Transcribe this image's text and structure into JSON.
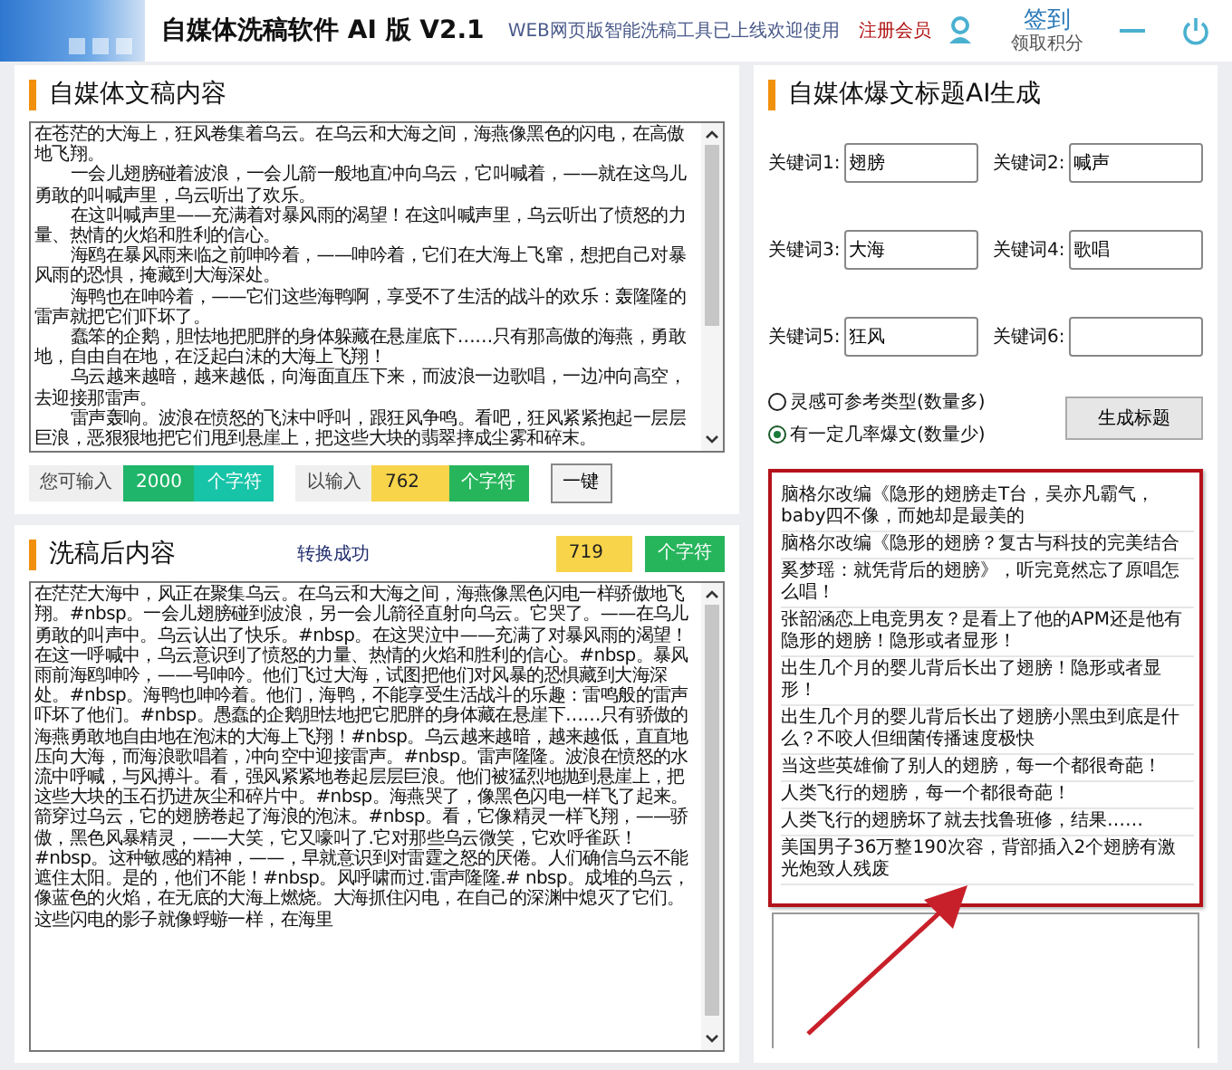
{
  "header": {
    "title": "自媒体洗稿软件 AI 版 V2.1",
    "notice": "WEB网页版智能洗稿工具已上线欢迎使用",
    "register": "注册会员",
    "checkin": "签到",
    "checkin_sub": "领取积分"
  },
  "source": {
    "title": "自媒体文稿内容",
    "paragraphs": [
      "在苍茫的大海上，狂风卷集着乌云。在乌云和大海之间，海燕像黑色的闪电，在高傲地飞翔。",
      "一会儿翅膀碰着波浪，一会儿箭一般地直冲向乌云，它叫喊着，——就在这鸟儿勇敢的叫喊声里，乌云听出了欢乐。",
      "在这叫喊声里——充满着对暴风雨的渴望！在这叫喊声里，乌云听出了愤怒的力量、热情的火焰和胜利的信心。",
      "海鸥在暴风雨来临之前呻吟着，——呻吟着，它们在大海上飞窜，想把自己对暴风雨的恐惧，掩藏到大海深处。",
      "海鸭也在呻吟着，——它们这些海鸭啊，享受不了生活的战斗的欢乐：轰隆隆的雷声就把它们吓坏了。",
      "蠢笨的企鹅，胆怯地把肥胖的身体躲藏在悬崖底下……只有那高傲的海燕，勇敢地，自由自在地，在泛起白沫的大海上飞翔！",
      "乌云越来越暗，越来越低，向海面直压下来，而波浪一边歌唱，一边冲向高空，去迎接那雷声。",
      "雷声轰响。波浪在愤怒的飞沫中呼叫，跟狂风争鸣。看吧，狂风紧紧抱起一层层巨浪，恶狠狠地把它们甩到悬崖上，把这些大块的翡翠摔成尘雾和碎末。"
    ],
    "limit_label": "您可输入",
    "limit_count": "2000",
    "limit_unit": "个字符",
    "input_label": "以输入",
    "input_count": "762",
    "input_unit": "个字符",
    "action_button": "一键"
  },
  "output": {
    "title": "洗稿后内容",
    "status": "转换成功",
    "count": "719",
    "unit": "个字符",
    "text": "在茫茫大海中，风正在聚集乌云。在乌云和大海之间，海燕像黑色闪电一样骄傲地飞翔。#nbsp。一会儿翅膀碰到波浪，另一会儿箭径直射向乌云。它哭了。——在乌儿勇敢的叫声中。乌云认出了快乐。#nbsp。在这哭泣中——充满了对暴风雨的渴望！在这一呼喊中，乌云意识到了愤怒的力量、热情的火焰和胜利的信心。#nbsp。暴风雨前海鸥呻吟，——号呻吟。他们飞过大海，试图把他们对风暴的恐惧藏到大海深处。#nbsp。海鸭也呻吟着。他们，海鸭，不能享受生活战斗的乐趣：雷鸣般的雷声吓坏了他们。#nbsp。愚蠢的企鹅胆怯地把它肥胖的身体藏在悬崖下……只有骄傲的海燕勇敢地自由地在泡沫的大海上飞翔！#nbsp。乌云越来越暗，越来越低，直直地压向大海，而海浪歌唱着，冲向空中迎接雷声。#nbsp。雷声隆隆。波浪在愤怒的水流中呼喊，与风搏斗。看，强风紧紧地卷起层层巨浪。他们被猛烈地抛到悬崖上，把这些大块的玉石扔进灰尘和碎片中。#nbsp。海燕哭了，像黑色闪电一样飞了起来。箭穿过乌云，它的翅膀卷起了海浪的泡沫。#nbsp。看，它像精灵一样飞翔，——骄傲，黑色风暴精灵，——大笑，它又嚎叫了.它对那些乌云微笑，它欢呼雀跃！#nbsp。这种敏感的精神，——，早就意识到对雷霆之怒的厌倦。人们确信乌云不能遮住太阳。是的，他们不能！#nbsp。风呼啸而过.雷声隆隆.# nbsp。成堆的乌云，像蓝色的火焰，在无底的大海上燃烧。大海抓住闪电，在自己的深渊中熄灭了它们。这些闪电的影子就像蜉蝣一样，在海里"
  },
  "generator": {
    "title": "自媒体爆文标题AI生成",
    "keywords": [
      {
        "label": "关键词1:",
        "value": "翅膀"
      },
      {
        "label": "关键词2:",
        "value": "喊声"
      },
      {
        "label": "关键词3:",
        "value": "大海"
      },
      {
        "label": "关键词4:",
        "value": "歌唱"
      },
      {
        "label": "关键词5:",
        "value": "狂风"
      },
      {
        "label": "关键词6:"
      }
    ],
    "modes": [
      {
        "label": "灵感可参考类型(数量多)",
        "selected": false
      },
      {
        "label": "有一定几率爆文(数量少)",
        "selected": true
      }
    ],
    "generate_button": "生成标题",
    "results": [
      "脑格尔改编《隐形的翅膀走T台，吴亦凡霸气，baby四不像，而她却是最美的",
      "脑格尔改编《隐形的翅膀？复古与科技的完美结合",
      "奚梦瑶：就凭背后的翅膀》，听完竟然忘了原唱怎么唱！",
      "张韶涵恋上电竞男友？是看上了他的APM还是他有隐形的翅膀！隐形或者显形！",
      "出生几个月的婴儿背后长出了翅膀！隐形或者显形！",
      "出生几个月的婴儿背后长出了翅膀小黑虫到底是什么？不咬人但细菌传播速度极快",
      "当这些英雄偷了别人的翅膀，每一个都很奇葩！",
      "人类飞行的翅膀，每一个都很奇葩！",
      "人类飞行的翅膀坏了就去找鲁班修，结果……",
      "美国男子36万整190次容，背部插入2个翅膀有激光炮致人残废"
    ]
  }
}
